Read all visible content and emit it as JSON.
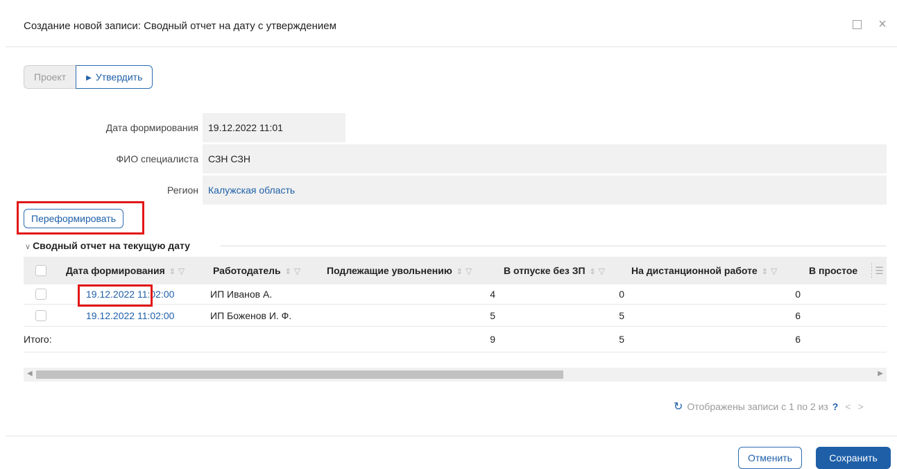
{
  "dialog": {
    "title": "Создание новой записи: Сводный отчет на дату с утверждением",
    "maximize_icon": "maximize-icon",
    "close_icon": "close-icon",
    "close_glyph": "×"
  },
  "states": {
    "draft_label": "Проект",
    "approve_label": "Утвердить",
    "approve_glyph": "▶"
  },
  "fields": [
    {
      "label": "Дата формирования",
      "value": "19.12.2022 11:01"
    },
    {
      "label": "ФИО специалиста",
      "value": "СЗН СЗН"
    },
    {
      "label": "Регион",
      "value": "Калужская область"
    }
  ],
  "reform_button": "Переформировать",
  "section": {
    "chevron": "∨",
    "title": "Сводный отчет на текущую дату"
  },
  "table": {
    "columns": [
      "Дата формирования",
      "Работодатель",
      "Подлежащие увольнению",
      "В отпуске без ЗП",
      "На дистанционной работе",
      "В простое"
    ],
    "sort_glyph": "⇕",
    "filter_glyph": "▽",
    "menu_glyph": "☰",
    "rows": [
      {
        "date": "19.12.2022 11:02:00",
        "employer": "ИП Иванов А.",
        "dismissal": "4",
        "unpaid_leave": "0",
        "remote": "0"
      },
      {
        "date": "19.12.2022 11:02:00",
        "employer": "ИП Боженов И. Ф.",
        "dismissal": "5",
        "unpaid_leave": "5",
        "remote": "6"
      }
    ],
    "total": {
      "label": "Итого:",
      "dismissal": "9",
      "unpaid_leave": "5",
      "remote": "6"
    }
  },
  "pager": {
    "refresh_glyph": "↻",
    "text": "Отображены записи с 1 по 2 из",
    "unknown": "?",
    "prev": "<",
    "next": ">"
  },
  "footer": {
    "cancel_label": "Отменить",
    "save_label": "Сохранить"
  },
  "colors": {
    "accent": "#1e5fa8",
    "highlight": "#e21616"
  }
}
